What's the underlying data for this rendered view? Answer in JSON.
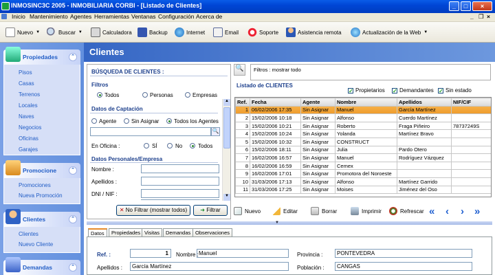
{
  "window": {
    "title": "INMOSINC3C 2005   -   INMOBILIARIA CORBI - [Listado de Clientes]",
    "min": "_",
    "max": "□",
    "close": "×"
  },
  "menu": [
    "Inicio",
    "Mantenimiento",
    "Agentes",
    "Herramientas",
    "Ventanas",
    "Configuración",
    "Acerca de"
  ],
  "toolbar": {
    "nuevo": "Nuevo",
    "buscar": "Buscar",
    "calculadora": "Calculadora",
    "backup": "Backup",
    "internet": "Internet",
    "email": "Email",
    "soporte": "Soporte",
    "asistencia": "Asistencia remota",
    "actualizacion": "Actualización de la Web"
  },
  "sidebar": {
    "propiedades": {
      "title": "Propiedades",
      "items": [
        "Pisos",
        "Casas",
        "Terrenos",
        "Locales",
        "Naves",
        "Negocios",
        "Oficinas",
        "Garajes"
      ]
    },
    "promocione": {
      "title": "Promocione",
      "items": [
        "Promociones",
        "Nueva Promoción"
      ]
    },
    "clientes": {
      "title": "Clientes",
      "items": [
        "Clientes",
        "Nuevo Cliente"
      ]
    },
    "demandas": {
      "title": "Demandas"
    }
  },
  "page": {
    "title": "Clientes"
  },
  "search": {
    "title": "BÚSQUEDA DE CLIENTES :",
    "filtros": "Filtros",
    "todos": "Todos",
    "personas": "Personas",
    "empresas": "Empresas",
    "captacion": "Datos de Captación",
    "agente": "Agente",
    "sin_asignar": "Sin Asignar",
    "todos_agentes": "Todos los Agentes",
    "en_oficina": "En Oficina :",
    "si": "SÍ",
    "no": "No",
    "todos2": "Todos",
    "personales": "Datos Personales/Empresa",
    "nombre": "Nombre :",
    "apellidos": "Apellidos :",
    "dni": "DNI / NIF :",
    "no_filtrar": "No Filtrar (mostrar todos)",
    "filtrar": "Filtrar"
  },
  "filter_status": "Filtros : mostrar todo",
  "listado": {
    "title": "Listado de CLIENTES",
    "propietarios": "Propietarios",
    "demandantes": "Demandantes",
    "sin_estado": "Sin estado"
  },
  "grid": {
    "columns": [
      "Ref.",
      "Fecha",
      "Agente",
      "Nombre",
      "Apellidos",
      "NIF/CIF"
    ],
    "rows": [
      [
        "1",
        "06/02/2006 17:35",
        "Sin Asignar",
        "Manuel",
        "García Martínez",
        ""
      ],
      [
        "2",
        "15/02/2006 10:18",
        "Sin Asignar",
        "Alfonso",
        "Cuerdo Martínez",
        ""
      ],
      [
        "3",
        "15/02/2006 10:21",
        "Sin Asignar",
        "Roberto",
        "Fraga Piñeiro",
        "78737249S"
      ],
      [
        "4",
        "15/02/2006 10:24",
        "Sin Asignar",
        "Yolanda",
        "Martínez Bravo",
        ""
      ],
      [
        "5",
        "15/02/2006 10:32",
        "Sin Asignar",
        "CONSTRUCT",
        "",
        " "
      ],
      [
        "6",
        "15/02/2006 18:11",
        "Sin Asignar",
        "Julia",
        "Pardo Otero",
        ""
      ],
      [
        "7",
        "16/02/2006 16:57",
        "Sin Asignar",
        "Manuel",
        "Rodríguez Vázquez",
        ""
      ],
      [
        "8",
        "16/02/2006 16:59",
        "Sin Asignar",
        "Cemex",
        "",
        ""
      ],
      [
        "9",
        "16/02/2006 17:01",
        "Sin Asignar",
        "Promotora del Noroeste",
        "",
        ""
      ],
      [
        "10",
        "31/03/2006 17:13",
        "Sin Asignar",
        "Alfonso",
        "Martínez Garrido",
        ""
      ],
      [
        "11",
        "31/03/2006 17:25",
        "Sin Asignar",
        "Moises",
        "Jiménez del Oso",
        ""
      ]
    ]
  },
  "actions": {
    "nuevo": "Nuevo",
    "editar": "Editar",
    "borrar": "Borrar",
    "imprimir": "Imprimir",
    "refrescar": "Refrescar"
  },
  "tabs": [
    "Datos",
    "Propiedades",
    "Visitas",
    "Demandas",
    "Observaciones"
  ],
  "detail": {
    "ref_label": "Ref. :",
    "ref_value": "1",
    "nombre_label": "Nombre :",
    "nombre_value": "Manuel",
    "apellidos_label": "Apellidos :",
    "apellidos_value": "García Martínez",
    "provincia_label": "Provincia :",
    "provincia_value": "PONTEVEDRA",
    "poblacion_label": "Población :",
    "poblacion_value": "CANGAS"
  }
}
